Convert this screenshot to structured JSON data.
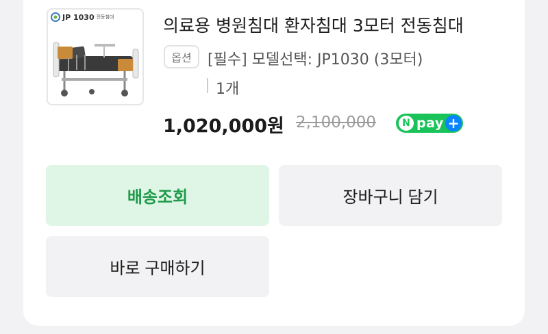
{
  "product": {
    "thumbnail": {
      "brand": "JP 1030",
      "brand_sub": "전동침대"
    },
    "title": "의료용 병원침대 환자침대 3모터 전동침대",
    "option_badge": "옵션",
    "option_text": "[필수] 모델선택: JP1030 (3모터)",
    "quantity": "1개",
    "price": "1,020,000원",
    "original_price": "2,100,000",
    "npay": {
      "n": "N",
      "pay": "pay",
      "plus": "+"
    }
  },
  "actions": {
    "track_label": "배송조회",
    "cart_label": "장바구니 담기",
    "buy_label": "바로 구매하기"
  },
  "colors": {
    "accent_green": "#1e9a4a",
    "track_bg": "#dff5e6",
    "npay_green": "#19c35a",
    "npay_plus_blue": "#0a84ff"
  }
}
